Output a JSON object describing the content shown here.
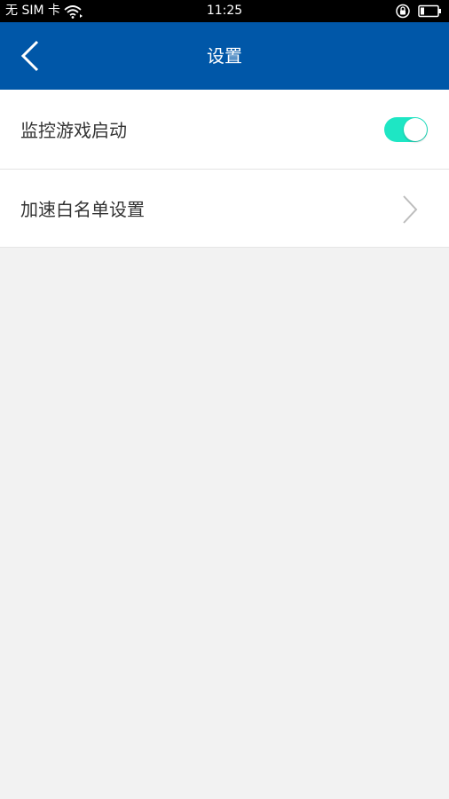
{
  "status_bar": {
    "carrier": "无 SIM 卡",
    "time": "11:25",
    "icons": [
      "wifi-icon",
      "rotation-lock-icon",
      "battery-icon"
    ]
  },
  "app_bar": {
    "title": "设置",
    "back_icon": "chevron-left-icon",
    "background": "#0057a8"
  },
  "settings": {
    "items": [
      {
        "label": "监控游戏启动",
        "control": "toggle",
        "enabled": true,
        "accent": "#1ee6c4"
      },
      {
        "label": "加速白名单设置",
        "control": "chevron-right-icon"
      }
    ]
  }
}
